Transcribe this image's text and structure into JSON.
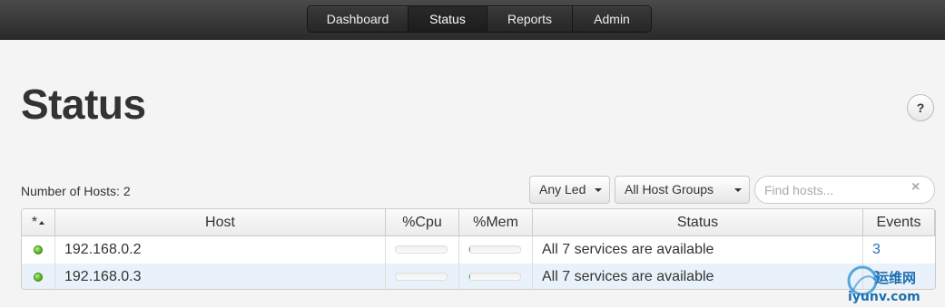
{
  "nav": {
    "items": [
      {
        "label": "Dashboard",
        "active": false
      },
      {
        "label": "Status",
        "active": true
      },
      {
        "label": "Reports",
        "active": false
      },
      {
        "label": "Admin",
        "active": false
      }
    ]
  },
  "page": {
    "title": "Status",
    "help_label": "?",
    "hosts_count": "Number of Hosts: 2"
  },
  "filters": {
    "led": "Any Led",
    "group": "All Host Groups",
    "search_placeholder": "Find hosts...",
    "clear": "×"
  },
  "table": {
    "headers": {
      "led": "*",
      "host": "Host",
      "cpu": "%Cpu",
      "mem": "%Mem",
      "status": "Status",
      "events": "Events"
    },
    "rows": [
      {
        "host": "192.168.0.2",
        "cpu": 0,
        "mem": 2,
        "status": "All 7 services are available",
        "events": "3"
      },
      {
        "host": "192.168.0.3",
        "cpu": 0,
        "mem": 2,
        "status": "All 7 services are available",
        "events": "3"
      }
    ]
  },
  "watermark": {
    "text_cn": "运维网",
    "text_en": "iyunv.com"
  },
  "colors": {
    "led_ok": "#4aa81a",
    "link": "#2a6fb7",
    "row_alt": "#e9f1fa"
  }
}
